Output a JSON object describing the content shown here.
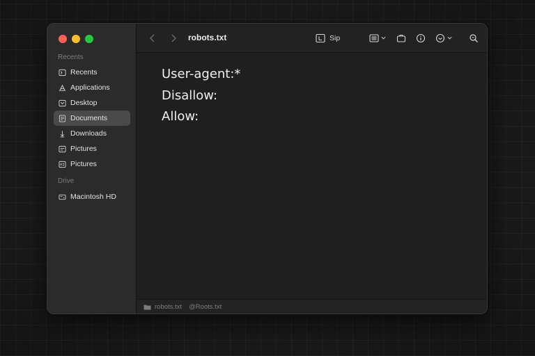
{
  "window": {
    "title": "robots.txt"
  },
  "sidebar": {
    "recents_header": "Recents",
    "drive_header": "Drive",
    "items": [
      {
        "label": "Recents",
        "icon": "recents-icon"
      },
      {
        "label": "Applications",
        "icon": "applications-icon"
      },
      {
        "label": "Desktop",
        "icon": "desktop-icon"
      },
      {
        "label": "Documents",
        "icon": "documents-icon",
        "selected": true
      },
      {
        "label": "Downloads",
        "icon": "downloads-icon"
      },
      {
        "label": "Pictures",
        "icon": "pictures-icon"
      },
      {
        "label": "Pictures",
        "icon": "pictures-icon"
      }
    ],
    "drives": [
      {
        "label": "Macintosh HD",
        "icon": "harddrive-icon"
      }
    ]
  },
  "toolbar": {
    "sip_label": "Sip"
  },
  "editor": {
    "lines": [
      "User-agent:*",
      "Disallow:",
      "Allow:"
    ]
  },
  "statusbar": {
    "file": "robots.txt",
    "handle": "@Roots.txt"
  },
  "colors": {
    "close": "#ff5f57",
    "minimize": "#febc2e",
    "zoom": "#28c840",
    "selection": "#4a4a4a"
  }
}
